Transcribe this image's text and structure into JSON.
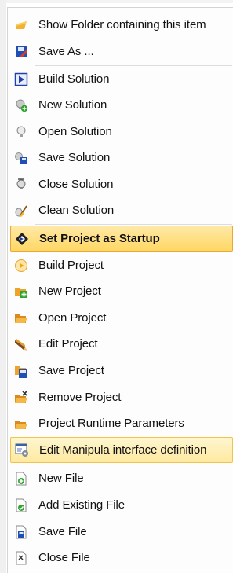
{
  "menu": {
    "items": [
      {
        "label": "Show Folder containing this item",
        "icon": "folder-open-icon"
      },
      {
        "label": "Save As ...",
        "icon": "save-as-icon"
      },
      {
        "label": "Build Solution",
        "icon": "build-solution-icon"
      },
      {
        "label": "New Solution",
        "icon": "new-solution-icon"
      },
      {
        "label": "Open Solution",
        "icon": "open-solution-icon"
      },
      {
        "label": "Save Solution",
        "icon": "save-solution-icon"
      },
      {
        "label": "Close Solution",
        "icon": "close-solution-icon"
      },
      {
        "label": "Clean Solution",
        "icon": "clean-solution-icon"
      },
      {
        "label": "Set Project as Startup",
        "icon": "set-startup-icon"
      },
      {
        "label": "Build Project",
        "icon": "build-project-icon"
      },
      {
        "label": "New Project",
        "icon": "new-project-icon"
      },
      {
        "label": "Open Project",
        "icon": "open-project-icon"
      },
      {
        "label": "Edit Project",
        "icon": "edit-project-icon"
      },
      {
        "label": "Save Project",
        "icon": "save-project-icon"
      },
      {
        "label": "Remove Project",
        "icon": "remove-project-icon"
      },
      {
        "label": "Project Runtime Parameters",
        "icon": "runtime-parameters-icon"
      },
      {
        "label": "Edit Manipula interface definition",
        "icon": "edit-interface-icon"
      },
      {
        "label": "New File",
        "icon": "new-file-icon"
      },
      {
        "label": "Add Existing File",
        "icon": "add-existing-file-icon"
      },
      {
        "label": "Save File",
        "icon": "save-file-icon"
      },
      {
        "label": "Close File",
        "icon": "close-file-icon"
      }
    ],
    "colors": {
      "highlight_bold": "#ffd764",
      "highlight_light": "#fde9a0",
      "separator": "#dcdcdc"
    }
  }
}
